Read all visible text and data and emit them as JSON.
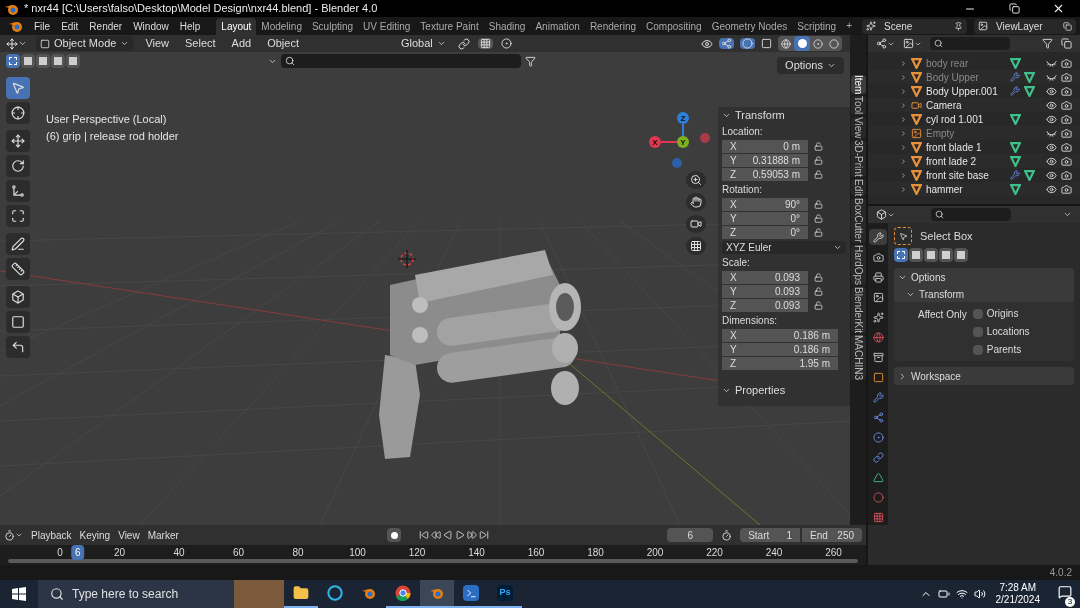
{
  "window": {
    "title": "* nxr44 [C:\\Users\\falso\\Desktop\\Model Design\\nxr44.blend] - Blender 4.0"
  },
  "menu": [
    "File",
    "Edit",
    "Render",
    "Window",
    "Help"
  ],
  "workspaces": [
    {
      "label": "Layout",
      "selected": true
    },
    {
      "label": "Modeling",
      "selected": false
    },
    {
      "label": "Sculpting",
      "selected": false
    },
    {
      "label": "UV Editing",
      "selected": false
    },
    {
      "label": "Texture Paint",
      "selected": false
    },
    {
      "label": "Shading",
      "selected": false
    },
    {
      "label": "Animation",
      "selected": false
    },
    {
      "label": "Rendering",
      "selected": false
    },
    {
      "label": "Compositing",
      "selected": false
    },
    {
      "label": "Geometry Nodes",
      "selected": false
    },
    {
      "label": "Scripting",
      "selected": false
    }
  ],
  "add_tab": "+",
  "scene": "Scene",
  "view_layer": "ViewLayer",
  "viewport": {
    "mode": "Object Mode",
    "menus": [
      "View",
      "Select",
      "Add",
      "Object"
    ],
    "orientation": "Global",
    "options": "Options",
    "select_modes": [
      {
        "selected": true
      },
      {
        "selected": false
      },
      {
        "selected": false
      },
      {
        "selected": false
      },
      {
        "selected": false
      }
    ],
    "shading": [
      {
        "kind": "wireframe",
        "selected": false
      },
      {
        "kind": "solid",
        "selected": true
      },
      {
        "kind": "material",
        "selected": false
      },
      {
        "kind": "rendered",
        "selected": false
      }
    ],
    "overlay_lines": [
      "User Perspective (Local)",
      "(6) grip | release rod holder"
    ],
    "tools": [
      {
        "kind": "select",
        "selected": true
      },
      {
        "kind": "cursor",
        "selected": false
      },
      {
        "kind": "move",
        "selected": false
      },
      {
        "kind": "rotate",
        "selected": false
      },
      {
        "kind": "scale",
        "selected": false
      },
      {
        "kind": "transform",
        "selected": false
      },
      {
        "kind": "annotate",
        "selected": false
      },
      {
        "kind": "measure",
        "selected": false
      },
      {
        "kind": "add_cube",
        "selected": false
      },
      {
        "kind": "shear",
        "selected": false
      },
      {
        "kind": "bend",
        "selected": false
      }
    ],
    "gizmo_axes": [
      {
        "label": "Z",
        "color": "#2f7fd8"
      },
      {
        "label": "Y",
        "color": "#7bb01e"
      },
      {
        "label": "X",
        "color": "#e0384f"
      }
    ]
  },
  "n_panel": {
    "title": "Transform",
    "sections": [
      {
        "kind": "fields",
        "label": "Location:",
        "locks": true,
        "fields": [
          {
            "axis": "X",
            "value": "0 m"
          },
          {
            "axis": "Y",
            "value": "0.31888 m"
          },
          {
            "axis": "Z",
            "value": "0.59053 m"
          }
        ]
      },
      {
        "kind": "fields",
        "label": "Rotation:",
        "locks": true,
        "fields": [
          {
            "axis": "X",
            "value": "90°"
          },
          {
            "axis": "Y",
            "value": "0°"
          },
          {
            "axis": "Z",
            "value": "0°"
          }
        ]
      },
      {
        "kind": "dropdown",
        "value": "XYZ Euler"
      },
      {
        "kind": "fields",
        "label": "Scale:",
        "locks": true,
        "fields": [
          {
            "axis": "X",
            "value": "0.093"
          },
          {
            "axis": "Y",
            "value": "0.093"
          },
          {
            "axis": "Z",
            "value": "0.093"
          }
        ]
      },
      {
        "kind": "fields",
        "label": "Dimensions:",
        "locks": false,
        "fields": [
          {
            "axis": "X",
            "value": "0.186 m"
          },
          {
            "axis": "Y",
            "value": "0.186 m"
          },
          {
            "axis": "Z",
            "value": "1.95 m"
          }
        ]
      }
    ],
    "properties": "Properties"
  },
  "side_tabs": [
    {
      "label": "Item",
      "selected": true
    },
    {
      "label": "Tool",
      "selected": false
    },
    {
      "label": "View",
      "selected": false
    },
    {
      "label": "3D-Print",
      "selected": false
    },
    {
      "label": "Edit",
      "selected": false
    },
    {
      "label": "BoxCutter",
      "selected": false
    },
    {
      "label": "HardOps",
      "selected": false
    },
    {
      "label": "BlenderKit",
      "selected": false
    },
    {
      "label": "MACHIN3",
      "selected": false
    }
  ],
  "outliner": {
    "items": [
      {
        "name": "body rear",
        "kind": "mesh",
        "visible": false,
        "modifier": false
      },
      {
        "name": "Body Upper",
        "kind": "mesh",
        "visible": false,
        "modifier": true
      },
      {
        "name": "Body Upper.001",
        "kind": "mesh",
        "visible": true,
        "modifier": true
      },
      {
        "name": "Camera",
        "kind": "camera",
        "visible": true,
        "modifier": false
      },
      {
        "name": "cyl rod 1.001",
        "kind": "mesh",
        "visible": true,
        "modifier": false
      },
      {
        "name": "Empty",
        "kind": "empty",
        "visible": false,
        "modifier": false
      },
      {
        "name": "front blade 1",
        "kind": "mesh",
        "visible": true,
        "modifier": false
      },
      {
        "name": "front lade 2",
        "kind": "mesh",
        "visible": true,
        "modifier": false
      },
      {
        "name": "front site base",
        "kind": "mesh",
        "visible": true,
        "modifier": true
      },
      {
        "name": "hammer",
        "kind": "mesh",
        "visible": true,
        "modifier": false
      }
    ]
  },
  "properties": {
    "tool": "Select Box",
    "tool_modes": [
      {
        "selected": true
      },
      {
        "selected": false
      },
      {
        "selected": false
      },
      {
        "selected": false
      },
      {
        "selected": false
      }
    ],
    "tabs": [
      {
        "kind": "tool",
        "selected": true
      },
      {
        "kind": "render",
        "selected": false
      },
      {
        "kind": "output",
        "selected": false
      },
      {
        "kind": "view_layer",
        "selected": false
      },
      {
        "kind": "scene",
        "selected": false
      },
      {
        "kind": "world",
        "selected": false
      },
      {
        "kind": "collection",
        "selected": false
      },
      {
        "kind": "object",
        "selected": false
      },
      {
        "kind": "modifier",
        "selected": false
      },
      {
        "kind": "particles",
        "selected": false
      },
      {
        "kind": "physics",
        "selected": false
      },
      {
        "kind": "constraints",
        "selected": false
      },
      {
        "kind": "data",
        "selected": false
      },
      {
        "kind": "material",
        "selected": false
      },
      {
        "kind": "texture",
        "selected": false
      }
    ],
    "panels": [
      {
        "title": "Options",
        "expanded": true,
        "subpanel": "Transform",
        "affect_label": "Affect Only",
        "checks": [
          {
            "label": "Origins",
            "checked": false
          },
          {
            "label": "Locations",
            "checked": false
          },
          {
            "label": "Parents",
            "checked": false
          }
        ]
      },
      {
        "title": "Workspace",
        "expanded": false
      }
    ]
  },
  "timeline": {
    "menus": [
      "Playback",
      "Keying",
      "View",
      "Marker"
    ],
    "current": "6",
    "start_label": "Start",
    "start": "1",
    "end_label": "End",
    "end": "250",
    "ruler": [
      "0",
      "20",
      "40",
      "60",
      "80",
      "100",
      "120",
      "140",
      "160",
      "180",
      "200",
      "220",
      "240",
      "260"
    ],
    "playhead": "6"
  },
  "status": {
    "version": "4.0.2"
  },
  "taskbar": {
    "search": "Type here to search",
    "apps": [
      {
        "kind": "explorer",
        "running": true,
        "selected": false
      },
      {
        "kind": "cortana",
        "running": false,
        "selected": false
      },
      {
        "kind": "blender",
        "running": false,
        "selected": false
      },
      {
        "kind": "chrome",
        "running": true,
        "selected": false
      },
      {
        "kind": "blender",
        "running": true,
        "selected": true
      },
      {
        "kind": "terminal",
        "running": true,
        "selected": false
      },
      {
        "kind": "photoshop",
        "label": "Ps",
        "running": true,
        "selected": false
      }
    ],
    "time": "7:28 AM",
    "date": "2/21/2024",
    "notifications": "3"
  }
}
